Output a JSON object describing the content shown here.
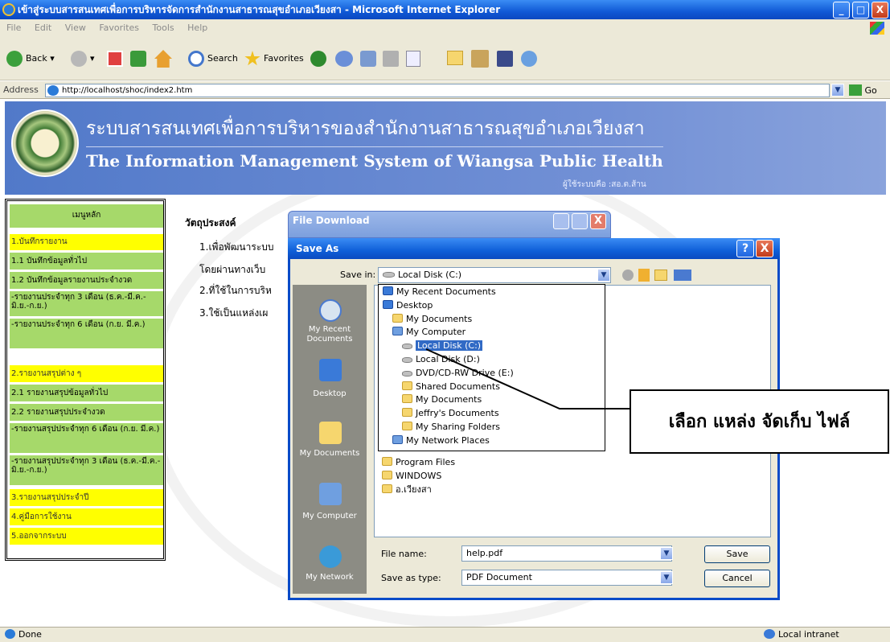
{
  "window": {
    "title": "เข้าสู่ระบบสารสนเทศเพื่อการบริหารจัดการสำนักงานสาธารณสุขอำเภอเวียงสา - Microsoft Internet Explorer",
    "minimize": "_",
    "maximize": "□",
    "close": "X"
  },
  "menu": [
    "File",
    "Edit",
    "View",
    "Favorites",
    "Tools",
    "Help"
  ],
  "toolbar": {
    "back": "Back",
    "search": "Search",
    "favorites": "Favorites"
  },
  "address": {
    "label": "Address",
    "url": "http://localhost/shoc/index2.htm",
    "go": "Go"
  },
  "banner": {
    "title_th": "ระบบสารสนเทศเพื่อการบริหารของสำนักงานสาธารณสุขอำเภอเวียงสา",
    "title_en": "The Information Management System of Wiangsa Public Health",
    "admin": "ผู้ใช้ระบบคือ :สอ.ต.ส้าน"
  },
  "sidebar": {
    "header": "เมนูหลัก",
    "items": [
      {
        "label": "1.บันทึกรายงาน",
        "style": "yellow"
      },
      {
        "label": "1.1 บันทึกข้อมูลทั่วไป",
        "style": "green"
      },
      {
        "label": "1.2 บันทึกข้อมูลรายงานประจำงวด",
        "style": "green"
      },
      {
        "label": "-รายงานประจำทุก 3 เดือน (ธ.ค.-มี.ค.-มิ.ย.-ก.ย.)",
        "style": "green"
      },
      {
        "label": "-รายงานประจำทุก 6 เดือน (ก.ย. มี.ค.)",
        "style": "green"
      },
      {
        "label": "2.รายงานสรุปต่าง ๆ",
        "style": "yellow"
      },
      {
        "label": "2.1 รายงานสรุปข้อมูลทั่วไป",
        "style": "green"
      },
      {
        "label": "2.2 รายงานสรุปประจำงวด",
        "style": "green"
      },
      {
        "label": "-รายงานสรุปประจำทุก 6 เดือน (ก.ย. มี.ค.)",
        "style": "green"
      },
      {
        "label": "-รายงานสรุปประจำทุก 3 เดือน (ธ.ค.-มี.ค.-มิ.ย.-ก.ย.)",
        "style": "green"
      },
      {
        "label": "3.รายงานสรุปประจำปี",
        "style": "yellow"
      },
      {
        "label": "4.คู่มือการใช้งาน",
        "style": "yellow"
      },
      {
        "label": "5.ออกจากระบบ",
        "style": "yellow"
      }
    ]
  },
  "content": {
    "heading": "วัตถุประสงค์",
    "lines": [
      "1.เพื่อพัฒนาระบบ",
      "โดยผ่านทางเว็บ",
      "2.ที่ใช้ในการบริห",
      "3.ใช้เป็นแหล่งเผ"
    ]
  },
  "file_download": {
    "title": "File Download"
  },
  "save_as": {
    "title": "Save As",
    "help": "?",
    "close": "X",
    "save_in_label": "Save in:",
    "save_in_value": "Local Disk (C:)",
    "places": [
      "My Recent Documents",
      "Desktop",
      "My Documents",
      "My Computer",
      "My Network"
    ],
    "dropdown_items": [
      {
        "label": "My Recent Documents",
        "icon": "ico-blue",
        "indent": 0
      },
      {
        "label": "Desktop",
        "icon": "ico-blue",
        "indent": 0
      },
      {
        "label": "My Documents",
        "icon": "ico-folder",
        "indent": 1
      },
      {
        "label": "My Computer",
        "icon": "ico-pc",
        "indent": 1
      },
      {
        "label": "Local Disk (C:)",
        "icon": "ico-disk",
        "indent": 2,
        "selected": true
      },
      {
        "label": "Local Disk (D:)",
        "icon": "ico-disk",
        "indent": 2
      },
      {
        "label": "DVD/CD-RW Drive (E:)",
        "icon": "ico-disk",
        "indent": 2
      },
      {
        "label": "Shared Documents",
        "icon": "ico-folder",
        "indent": 2
      },
      {
        "label": "My Documents",
        "icon": "ico-folder",
        "indent": 2
      },
      {
        "label": "Jeffry's Documents",
        "icon": "ico-folder",
        "indent": 2
      },
      {
        "label": "My Sharing Folders",
        "icon": "ico-folder",
        "indent": 2
      },
      {
        "label": "My Network Places",
        "icon": "ico-pc",
        "indent": 1
      }
    ],
    "files": [
      "Program Files",
      "WINDOWS",
      "อ.เวียงสา"
    ],
    "file_name_label": "File name:",
    "file_name_value": "help.pdf",
    "save_type_label": "Save as type:",
    "save_type_value": "PDF Document",
    "save_button": "Save",
    "cancel_button": "Cancel"
  },
  "callout": "เลือก แหล่ง จัดเก็บ ไฟล์",
  "status": {
    "left": "Done",
    "right": "Local intranet"
  }
}
